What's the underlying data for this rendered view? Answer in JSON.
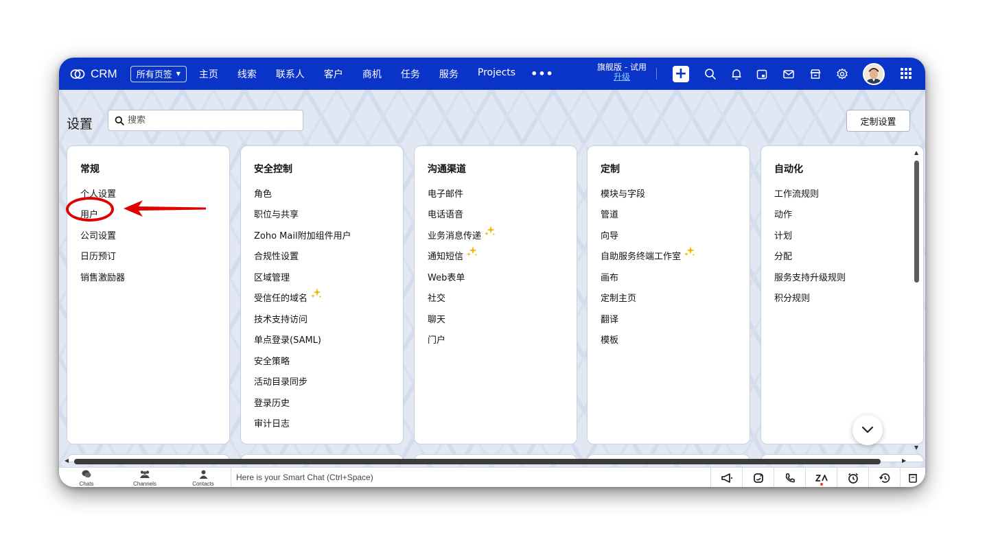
{
  "app": {
    "name": "CRM"
  },
  "topbar": {
    "all_tabs_label": "所有页签",
    "nav_items": [
      "主页",
      "线索",
      "联系人",
      "客户",
      "商机",
      "任务",
      "服务",
      "Projects"
    ],
    "more": "•••",
    "edition": "旗舰版 - 试用",
    "upgrade": "升级"
  },
  "header": {
    "title": "设置",
    "search_placeholder": "搜索",
    "customize_button": "定制设置"
  },
  "sections": [
    {
      "title": "常规",
      "items": [
        {
          "label": "个人设置"
        },
        {
          "label": "用户"
        },
        {
          "label": "公司设置"
        },
        {
          "label": "日历预订"
        },
        {
          "label": "销售激励器"
        }
      ]
    },
    {
      "title": "安全控制",
      "items": [
        {
          "label": "角色"
        },
        {
          "label": "职位与共享"
        },
        {
          "label": "Zoho Mail附加组件用户"
        },
        {
          "label": "合规性设置"
        },
        {
          "label": "区域管理"
        },
        {
          "label": "受信任的域名",
          "sparkle": true
        },
        {
          "label": "技术支持访问"
        },
        {
          "label": "单点登录(SAML)"
        },
        {
          "label": "安全策略"
        },
        {
          "label": "活动目录同步"
        },
        {
          "label": "登录历史"
        },
        {
          "label": "审计日志"
        }
      ]
    },
    {
      "title": "沟通渠道",
      "items": [
        {
          "label": "电子邮件"
        },
        {
          "label": "电话语音"
        },
        {
          "label": "业务消息传递",
          "sparkle": true
        },
        {
          "label": "通知短信",
          "sparkle": true
        },
        {
          "label": "Web表单"
        },
        {
          "label": "社交"
        },
        {
          "label": "聊天"
        },
        {
          "label": "门户"
        }
      ]
    },
    {
      "title": "定制",
      "items": [
        {
          "label": "模块与字段"
        },
        {
          "label": "管道"
        },
        {
          "label": "向导"
        },
        {
          "label": "自助服务终端工作室",
          "sparkle": true
        },
        {
          "label": "画布"
        },
        {
          "label": "定制主页"
        },
        {
          "label": "翻译"
        },
        {
          "label": "模板"
        }
      ]
    },
    {
      "title": "自动化",
      "items": [
        {
          "label": "工作流规则"
        },
        {
          "label": "动作"
        },
        {
          "label": "计划"
        },
        {
          "label": "分配"
        },
        {
          "label": "服务支持升级规则"
        },
        {
          "label": "积分规则"
        }
      ]
    }
  ],
  "bottombar": {
    "chats": "Chats",
    "channels": "Channels",
    "contacts": "Contacts",
    "smart_chat": "Here is your Smart Chat (Ctrl+Space)"
  },
  "icons": {
    "logo": "zoho-crm-logo-icon",
    "search": "search-icon",
    "bell": "bell-icon",
    "calendar": "calendar-icon",
    "mail": "mail-icon",
    "store": "marketplace-icon",
    "settings": "gear-icon",
    "apps": "app-grid-icon",
    "sparkle": "sparkle-icon"
  },
  "colors": {
    "topbar": "#0a33c8",
    "accent_sparkle": "#f2b705",
    "annotation_red": "#e00000"
  }
}
